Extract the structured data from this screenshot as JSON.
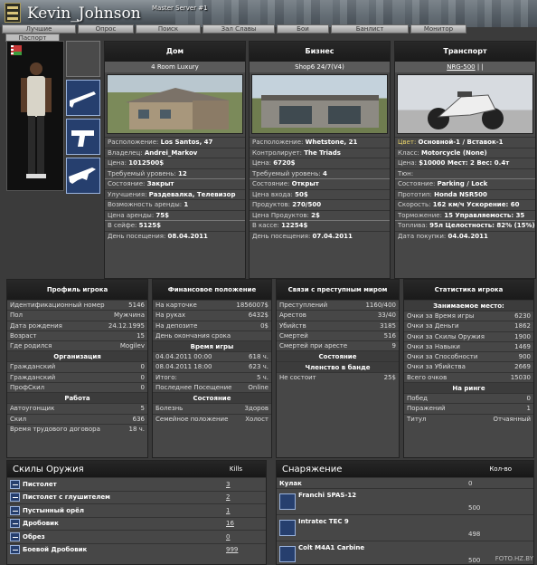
{
  "header": {
    "player_name": "Kevin_Johnson",
    "server_name": "Master Server #1",
    "tabs": [
      "Лучшие",
      "Опрос",
      "Поиск",
      "Зал Славы",
      "Бои",
      "Банлист",
      "Монитор"
    ],
    "subtab": "Паспорт"
  },
  "house": {
    "title": "Дом",
    "subtitle": "4 Room Luxury",
    "rows": [
      {
        "label": "Расположение:",
        "value": "Los Santos, 47"
      },
      {
        "label": "Владелец:",
        "value": "Andrei_Markov"
      },
      {
        "label": "Цена:",
        "value": "1012500$"
      },
      {
        "label": "Требуемый уровень:",
        "value": "12"
      },
      {
        "label": "Состояние:",
        "value": "Закрыт"
      },
      {
        "label": "Улучшения:",
        "value": "Раздевалка, Телевизор"
      },
      {
        "label": "Возможность аренды:",
        "value": "1"
      },
      {
        "label": "Цена аренды:",
        "value": "75$"
      },
      {
        "label": "В сейфе:",
        "value": "5125$"
      },
      {
        "label": "День посещения:",
        "value": "08.04.2011"
      }
    ]
  },
  "business": {
    "title": "Бизнес",
    "subtitle": "Shop6 24/7(V4)",
    "rows": [
      {
        "label": "Расположение:",
        "value": "Whetstone, 21"
      },
      {
        "label": "Контролирует:",
        "value": "The Triads"
      },
      {
        "label": "Цена:",
        "value": "6720$"
      },
      {
        "label": "Требуемый уровень:",
        "value": "4"
      },
      {
        "label": "Состояние:",
        "value": "Открыт"
      },
      {
        "label": "Цена входа:",
        "value": "50$"
      },
      {
        "label": "Продуктов:",
        "value": "270/500"
      },
      {
        "label": "Цена Продуктов:",
        "value": "2$"
      },
      {
        "label": "В кассе:",
        "value": "12254$"
      },
      {
        "label": "День посещения:",
        "value": "07.04.2011"
      }
    ]
  },
  "transport": {
    "title": "Транспорт",
    "subtitle": "NRG-500",
    "subtitle_extra": " | |",
    "rows": [
      {
        "label": "Цвет:",
        "value": "Основной-1 / Вставок-1"
      },
      {
        "label": "Класс:",
        "value": "Motorcycle (None)"
      },
      {
        "label": "Цена:",
        "value": "$10000 Мест: 2 Вес: 0.4т"
      },
      {
        "label": "Тюн:",
        "value": ""
      },
      {
        "label": "Состояние:",
        "value": "Parking / Lock"
      },
      {
        "label": "Прототип:",
        "value": "Honda NSR500"
      },
      {
        "label": "Скорость:",
        "value": "162 км/ч Ускорение: 60"
      },
      {
        "label": "Торможение:",
        "value": "15 Управляемость: 35"
      },
      {
        "label": "Топлива:",
        "value": "95л Целостность: 82% (15%)"
      },
      {
        "label": "Дата покупки:",
        "value": "04.04.2011"
      }
    ]
  },
  "profile": {
    "title": "Профиль игрока",
    "rows": [
      {
        "label": "Идентификационный номер",
        "value": "5146"
      },
      {
        "label": "Пол",
        "value": "Мужчина"
      },
      {
        "label": "Дата рождения",
        "value": "24.12.1995"
      },
      {
        "label": "Возраст",
        "value": "15"
      },
      {
        "label": "Где родился",
        "value": "Mogilev"
      }
    ],
    "org_title": "Организация",
    "org_rows": [
      {
        "label": "Гражданский",
        "value": "0"
      },
      {
        "label": "Гражданский",
        "value": "0"
      },
      {
        "label": "ПрофСкил",
        "value": "0"
      }
    ],
    "work_title": "Работа",
    "work_rows": [
      {
        "label": "Автоугонщик",
        "value": "5"
      },
      {
        "label": "Скил",
        "value": "636"
      },
      {
        "label": "Время трудового договора",
        "value": "18 ч."
      }
    ]
  },
  "finance": {
    "title": "Финансовое положение",
    "rows": [
      {
        "label": "На карточке",
        "value": "1856007$"
      },
      {
        "label": "На руках",
        "value": "6432$"
      },
      {
        "label": "На депозите",
        "value": "0$"
      },
      {
        "label": "День окончания срока",
        "value": ""
      }
    ],
    "time_title": "Время игры",
    "time_rows": [
      {
        "label": "04.04.2011 00:00",
        "value": "618 ч."
      },
      {
        "label": "08.04.2011 18:00",
        "value": "623 ч."
      },
      {
        "label": "Итого:",
        "value": "5 ч."
      },
      {
        "label": "Последнее Посещение",
        "value": "Online"
      }
    ],
    "state_title": "Состояние",
    "state_rows": [
      {
        "label": "Болезнь",
        "value": "Здоров"
      },
      {
        "label": "Семейное положение",
        "value": "Холост"
      }
    ]
  },
  "crime": {
    "title": "Связи с преступным миром",
    "rows": [
      {
        "label": "Преступлений",
        "value": "1160/400"
      },
      {
        "label": "Арестов",
        "value": "33/40"
      },
      {
        "label": "Убийств",
        "value": "3185"
      },
      {
        "label": "Смертей",
        "value": "516"
      },
      {
        "label": "Смертей при аресте",
        "value": "9"
      }
    ],
    "state_title": "Состояние",
    "gang_title": "Членство в банде",
    "gang_rows": [
      {
        "label": "Не состоит",
        "value": "25$"
      }
    ]
  },
  "stats": {
    "title": "Статистика игрока",
    "place_title": "Занимаемое место:",
    "rows": [
      {
        "label": "Очки за Время игры",
        "value": "6230"
      },
      {
        "label": "Очки за Деньги",
        "value": "1862"
      },
      {
        "label": "Очки за Скилы Оружия",
        "value": "1900"
      },
      {
        "label": "Очки за Навыки",
        "value": "1469"
      },
      {
        "label": "Очки за Способности",
        "value": "900"
      },
      {
        "label": "Очки за Убийства",
        "value": "2669"
      },
      {
        "label": "Всего очков",
        "value": "15030"
      }
    ],
    "ring_title": "На ринге",
    "ring_rows": [
      {
        "label": "Побед",
        "value": "0"
      },
      {
        "label": "Поражений",
        "value": "1"
      },
      {
        "label": "Титул",
        "value": "Отчаянный"
      }
    ]
  },
  "weapons": {
    "title": "Скилы Оружия",
    "col": "Kills",
    "rows": [
      {
        "name": "Пистолет",
        "value": "3"
      },
      {
        "name": "Пистолет с глушителем",
        "value": "2"
      },
      {
        "name": "Пустынный орёл",
        "value": "1"
      },
      {
        "name": "Дробовик",
        "value": "16"
      },
      {
        "name": "Обрез",
        "value": "0"
      },
      {
        "name": "Боевой Дробовик",
        "value": "999"
      }
    ]
  },
  "equipment": {
    "title": "Снаряжение",
    "col": "Кол-во",
    "first": {
      "name": "Кулак",
      "value": "0"
    },
    "rows": [
      {
        "name": "Franchi SPAS-12",
        "value": "500"
      },
      {
        "name": "Intratec TEC 9",
        "value": "498"
      },
      {
        "name": "Colt M4A1 Carbine",
        "value": "500"
      }
    ]
  },
  "watermark": "FOTO.HZ.BY"
}
